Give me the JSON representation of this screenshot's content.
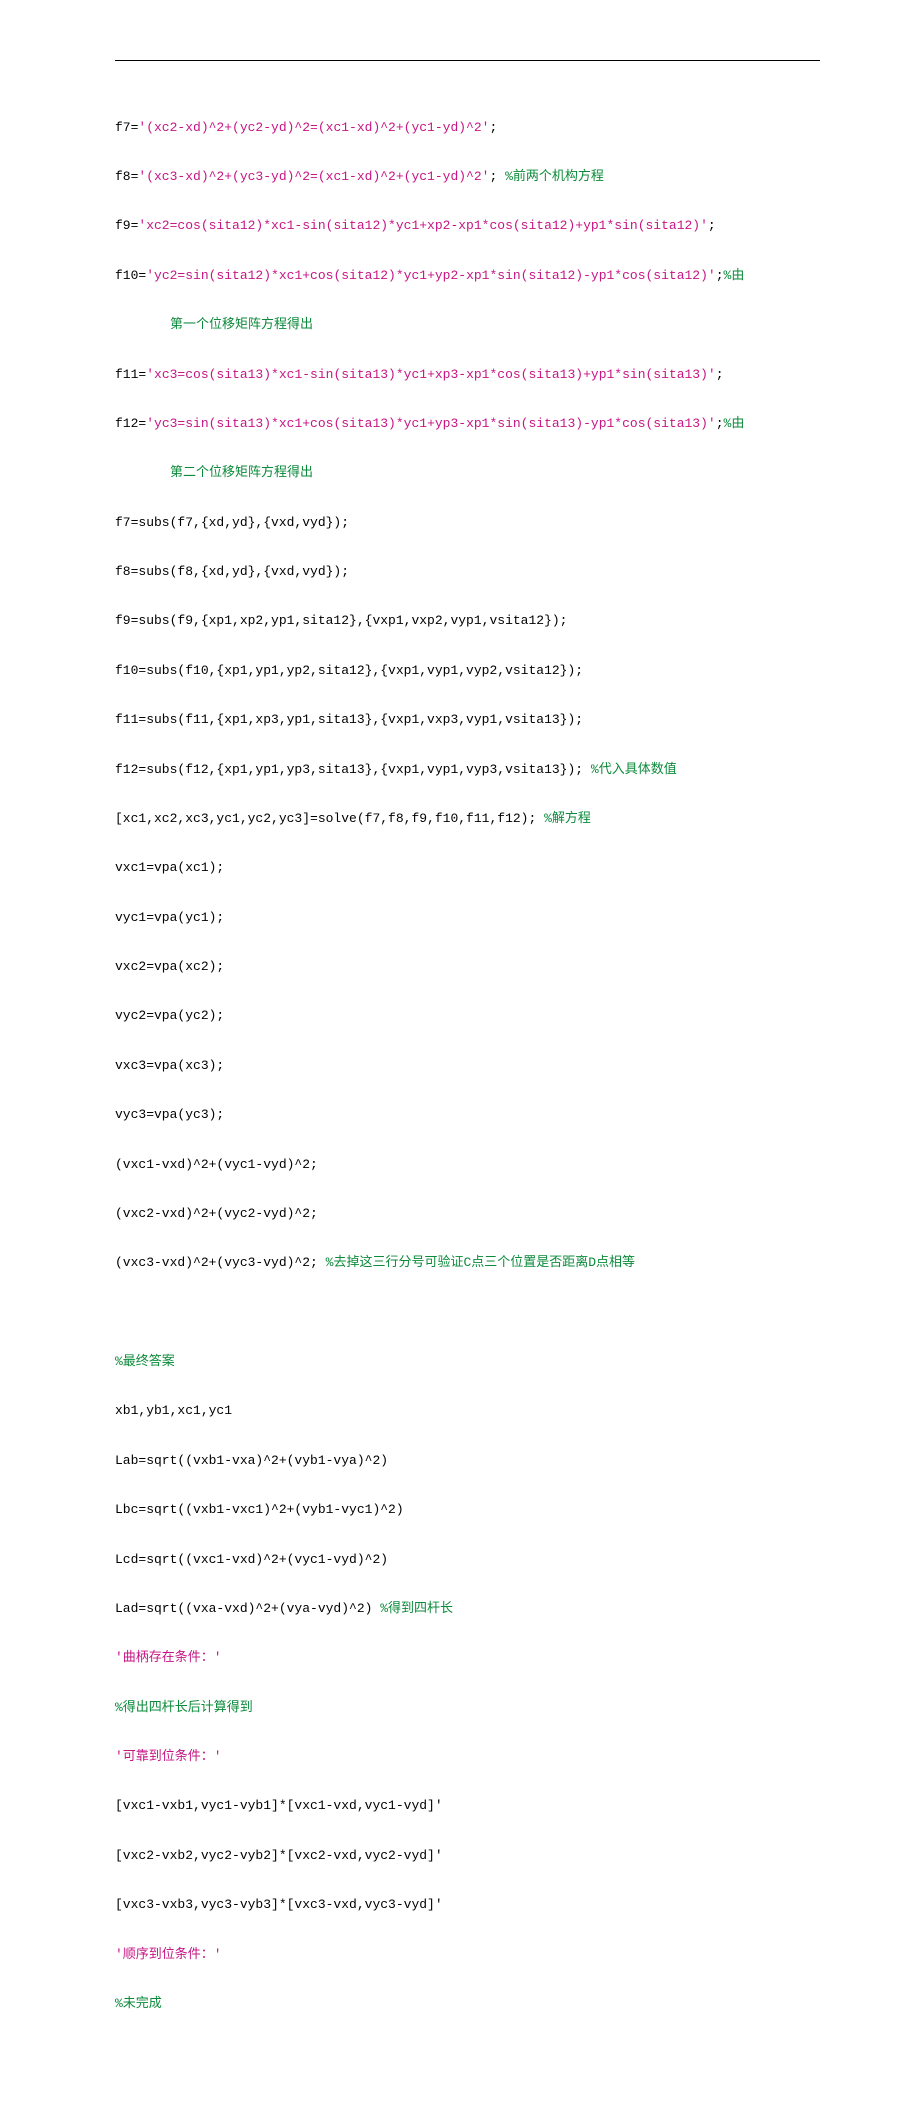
{
  "lines": {
    "l1_var": "f7=",
    "l1_str": "'(xc2-xd)^2+(yc2-yd)^2=(xc1-xd)^2+(yc1-yd)^2'",
    "l1_tail": ";",
    "l2_var": "f8=",
    "l2_str": "'(xc3-xd)^2+(yc3-yd)^2=(xc1-xd)^2+(yc1-yd)^2'",
    "l2_tail": "; ",
    "l2_cmt": "%前两个机构方程",
    "l3_var": "f9=",
    "l3_str": "'xc2=cos(sita12)*xc1-sin(sita12)*yc1+xp2-xp1*cos(sita12)+yp1*sin(sita12)'",
    "l3_tail": ";",
    "l4_var": "f10=",
    "l4_str": "'yc2=sin(sita12)*xc1+cos(sita12)*yc1+yp2-xp1*sin(sita12)-yp1*cos(sita12)'",
    "l4_tail": ";",
    "l4_cmt": "%由",
    "l4b_cmt": "第一个位移矩阵方程得出",
    "l5_var": "f11=",
    "l5_str": "'xc3=cos(sita13)*xc1-sin(sita13)*yc1+xp3-xp1*cos(sita13)+yp1*sin(sita13)'",
    "l5_tail": ";",
    "l6_var": "f12=",
    "l6_str": "'yc3=sin(sita13)*xc1+cos(sita13)*yc1+yp3-xp1*sin(sita13)-yp1*cos(sita13)'",
    "l6_tail": ";",
    "l6_cmt": "%由",
    "l6b_cmt": "第二个位移矩阵方程得出",
    "l7": "f7=subs(f7,{xd,yd},{vxd,vyd});",
    "l8": "f8=subs(f8,{xd,yd},{vxd,vyd});",
    "l9": "f9=subs(f9,{xp1,xp2,yp1,sita12},{vxp1,vxp2,vyp1,vsita12});",
    "l10": "f10=subs(f10,{xp1,yp1,yp2,sita12},{vxp1,vyp1,vyp2,vsita12});",
    "l11": "f11=subs(f11,{xp1,xp3,yp1,sita13},{vxp1,vxp3,vyp1,vsita13});",
    "l12a": "f12=subs(f12,{xp1,yp1,yp3,sita13},{vxp1,vyp1,vyp3,vsita13}); ",
    "l12_cmt": "%代入具体数值",
    "l13a": "[xc1,xc2,xc3,yc1,yc2,yc3]=solve(f7,f8,f9,f10,f11,f12); ",
    "l13_cmt": "%解方程",
    "l14": "vxc1=vpa(xc1);",
    "l15": "vyc1=vpa(yc1);",
    "l16": "vxc2=vpa(xc2);",
    "l17": "vyc2=vpa(yc2);",
    "l18": "vxc3=vpa(xc3);",
    "l19": "vyc3=vpa(yc3);",
    "l20": "(vxc1-vxd)^2+(vyc1-vyd)^2;",
    "l21": "(vxc2-vxd)^2+(vyc2-vyd)^2;",
    "l22a": "(vxc3-vxd)^2+(vyc3-vyd)^2; ",
    "l22_cmt": "%去掉这三行分号可验证C点三个位置是否距离D点相等",
    "blank": " ",
    "l23_cmt": "%最终答案",
    "l24": "xb1,yb1,xc1,yc1",
    "l25": "Lab=sqrt((vxb1-vxa)^2+(vyb1-vya)^2)",
    "l26": "Lbc=sqrt((vxb1-vxc1)^2+(vyb1-vyc1)^2)",
    "l27": "Lcd=sqrt((vxc1-vxd)^2+(vyc1-vyd)^2)",
    "l28a": "Lad=sqrt((vxa-vxd)^2+(vya-vyd)^2) ",
    "l28_cmt": "%得到四杆长",
    "l29_str": "'曲柄存在条件：'",
    "l30_cmt": "%得出四杆长后计算得到",
    "l31_str": "'可靠到位条件：'",
    "l32": "[vxc1-vxb1,vyc1-vyb1]*[vxc1-vxd,vyc1-vyd]'",
    "l33": "[vxc2-vxb2,vyc2-vyb2]*[vxc2-vxd,vyc2-vyd]'",
    "l34": "[vxc3-vxb3,vyc3-vyb3]*[vxc3-vxd,vyc3-vyd]'",
    "l35_str": "'顺序到位条件：'",
    "l36_cmt": "%未完成"
  }
}
